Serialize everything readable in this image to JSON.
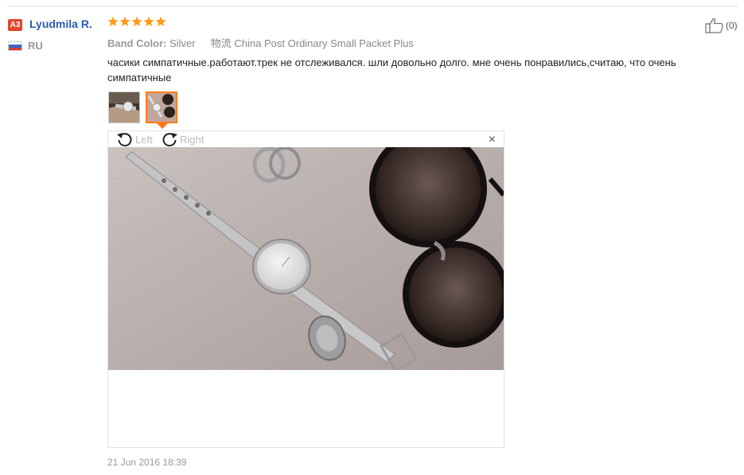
{
  "reviewer": {
    "badge": "A3",
    "name": "Lyudmila R.",
    "country": "RU"
  },
  "rating": {
    "stars": 5,
    "max": 5,
    "color": "#ff9a1e"
  },
  "meta": {
    "band_label": "Band Color:",
    "band_value": "Silver",
    "logistics_key": "物流",
    "logistics_value": "China Post Ordinary Small Packet Plus"
  },
  "helpful": {
    "count": "(0)",
    "icon": "thumbs-up-icon"
  },
  "review": {
    "text": "часики симпатичные.работают.трек не отслеживался. шли довольно долго. мне очень понравились,считаю, что очень симпатичные"
  },
  "viewer": {
    "rotate_left": "Left",
    "rotate_right": "Right",
    "close": "×",
    "selected_thumbnail": 2
  },
  "date": "21 Jun 2016 18:39"
}
